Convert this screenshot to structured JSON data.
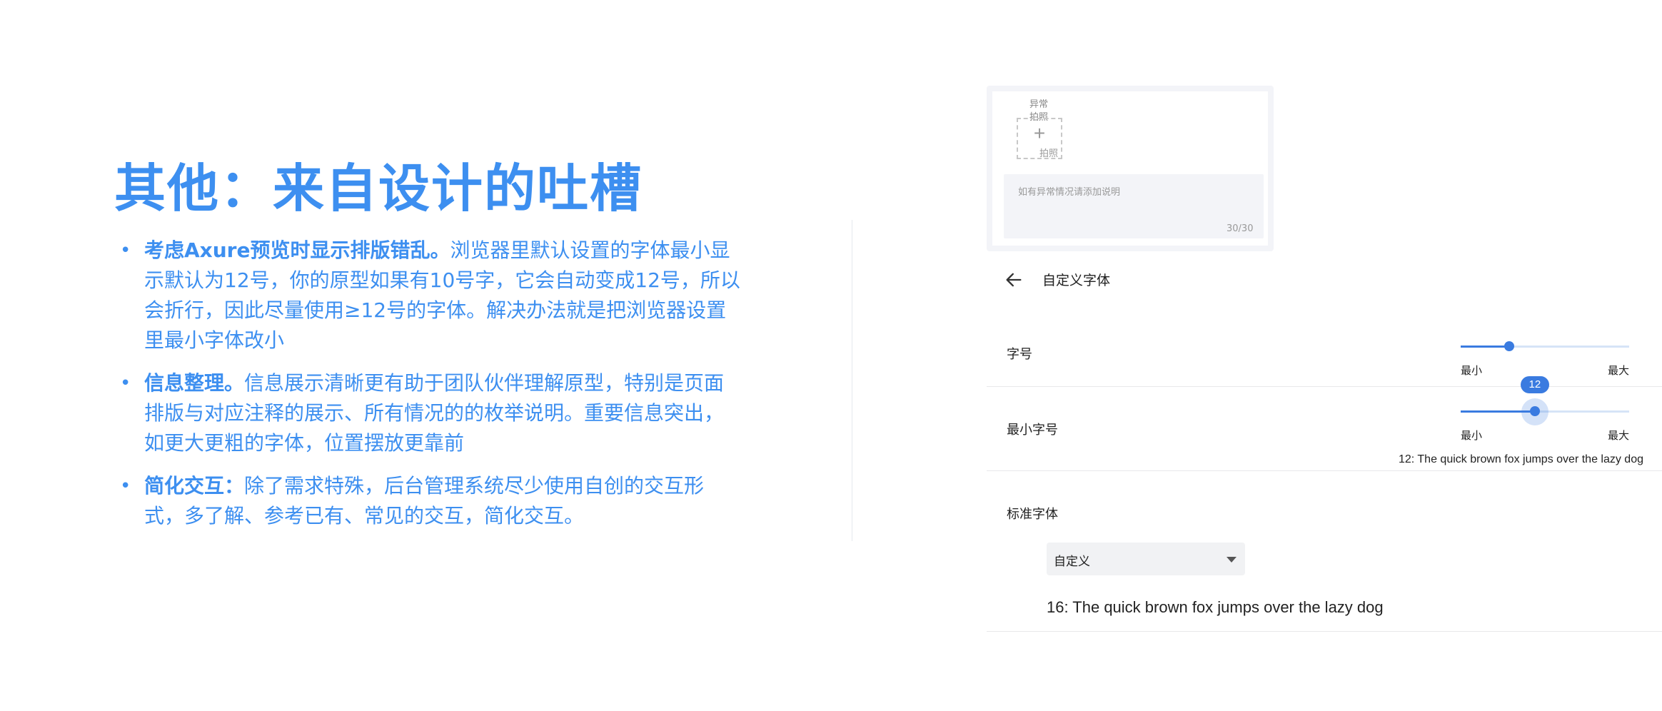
{
  "slide": {
    "title": "其他：来自设计的吐槽",
    "bullets": [
      {
        "bold": "考虑Axure预览时显示排版错乱。",
        "text": "浏览器里默认设置的字体最小显示默认为12号，你的原型如果有10号字，它会自动变成12号，所以会折行，因此尽量使用≥12号的字体。解决办法就是把浏览器设置里最小字体改小"
      },
      {
        "bold": "信息整理。",
        "text": "信息展示清晰更有助于团队伙伴理解原型，特别是页面排版与对应注释的展示、所有情况的的枚举说明。重要信息突出，如更大更粗的字体，位置摆放更靠前"
      },
      {
        "bold": "简化交互：",
        "text": "除了需求特殊，后台管理系统尽少使用自创的交互形式，多了解、参考已有、常见的交互，简化交互。"
      }
    ]
  },
  "upload_card": {
    "label": "异常拍照",
    "button_label": "拍照",
    "textarea_placeholder": "如有异常情况请添加说明",
    "char_count": "30/30"
  },
  "font_settings": {
    "back_icon": "arrow-left-icon",
    "title": "自定义字体",
    "font_size": {
      "label": "字号",
      "min_label": "最小",
      "max_label": "最大",
      "level": 0.29
    },
    "min_font_size": {
      "label": "最小字号",
      "min_label": "最小",
      "max_label": "最大",
      "value": "12",
      "level": 0.44
    },
    "min_preview": "12: The quick brown fox jumps over the lazy dog",
    "standard_font": {
      "label": "标准字体",
      "selected": "自定义"
    },
    "standard_preview": "16: The quick brown fox jumps over the lazy dog"
  },
  "colors": {
    "accent": "#3d8ff0",
    "slider": "#3a7be0"
  }
}
